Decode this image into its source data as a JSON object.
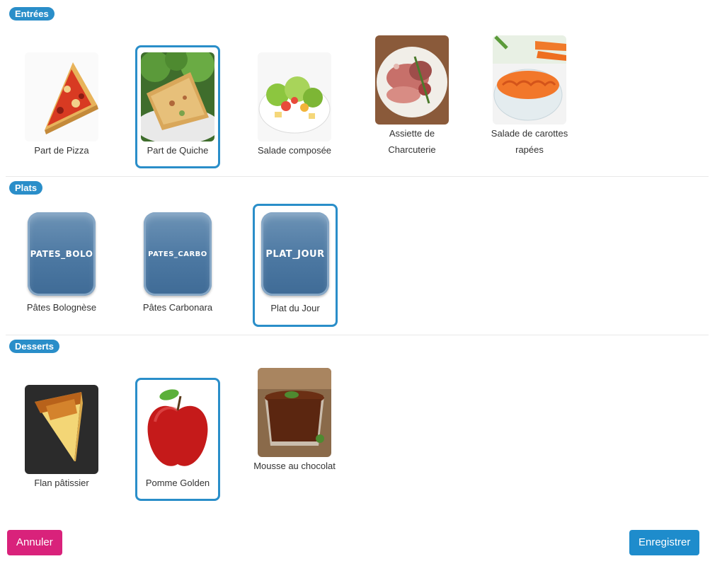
{
  "sections": {
    "entrees": {
      "title": "Entrées",
      "items": [
        {
          "label": "Part de Pizza",
          "selected": false,
          "icon": "pizza-image"
        },
        {
          "label": "Part de Quiche",
          "selected": true,
          "icon": "quiche-image"
        },
        {
          "label": "Salade composée",
          "selected": false,
          "icon": "salad-image"
        },
        {
          "label": "Assiette de Charcuterie",
          "selected": false,
          "icon": "charcuterie-image"
        },
        {
          "label": "Salade de carottes rapées",
          "selected": false,
          "icon": "carrot-salad-image"
        }
      ]
    },
    "plats": {
      "title": "Plats",
      "items": [
        {
          "label": "Pâtes Bolognèse",
          "tile_text": "PATES_BOLO",
          "selected": false
        },
        {
          "label": "Pâtes Carbonara",
          "tile_text": "PATES_CARBO",
          "selected": false
        },
        {
          "label": "Plat du Jour",
          "tile_text": "PLAT_JOUR",
          "selected": true
        }
      ]
    },
    "desserts": {
      "title": "Desserts",
      "items": [
        {
          "label": "Flan pâtissier",
          "selected": false,
          "icon": "flan-image"
        },
        {
          "label": "Pomme Golden",
          "selected": true,
          "icon": "apple-image"
        },
        {
          "label": "Mousse au chocolat",
          "selected": false,
          "icon": "chocolate-mousse-image"
        }
      ]
    }
  },
  "buttons": {
    "cancel": "Annuler",
    "save": "Enregistrer"
  },
  "colors": {
    "accent": "#2a8ec9",
    "cancel": "#d9227b",
    "save": "#1e8ccc"
  }
}
